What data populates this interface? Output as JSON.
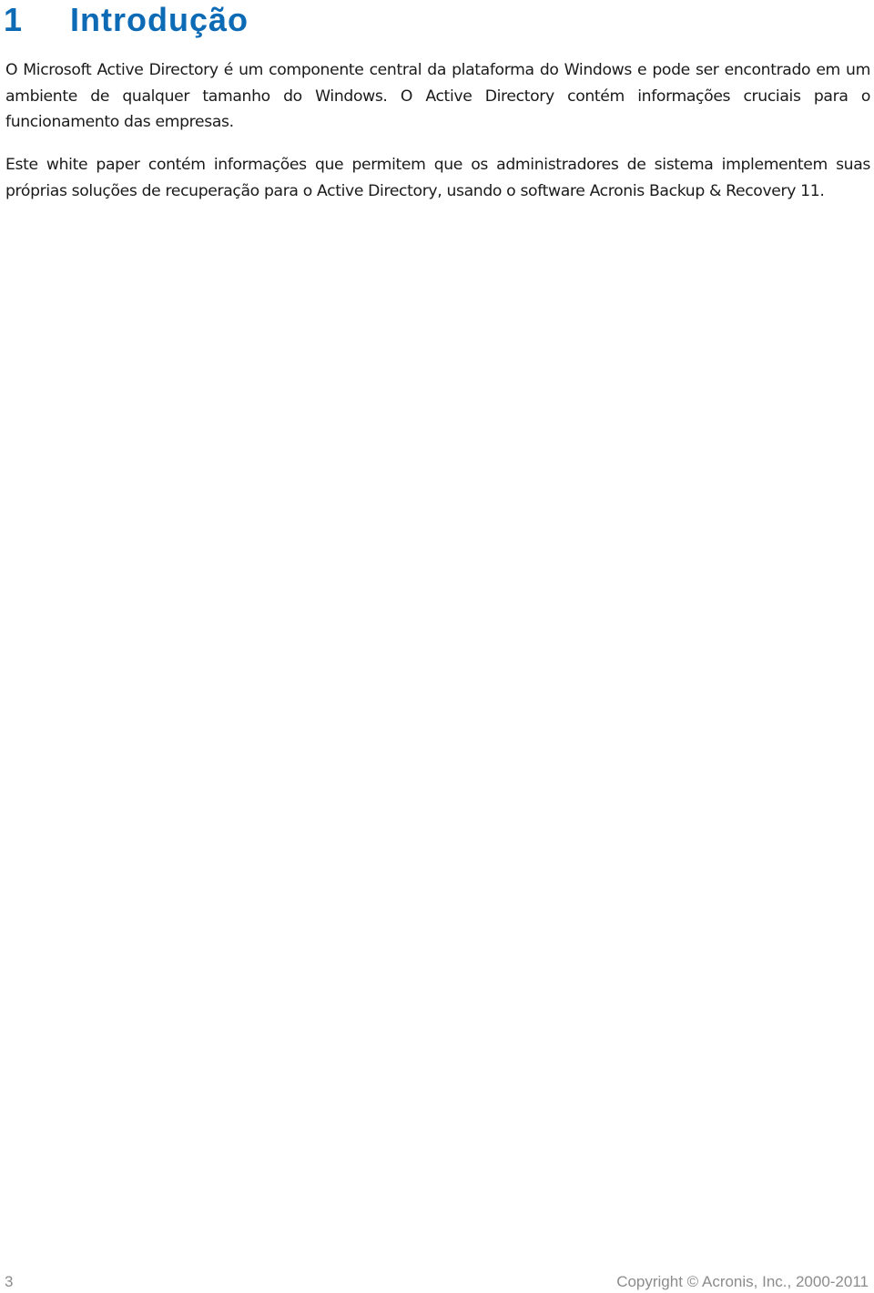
{
  "heading": {
    "number": "1",
    "title": "Introdução"
  },
  "paragraphs": [
    "O Microsoft Active Directory é um componente central da plataforma do Windows e pode ser encontrado em um ambiente de qualquer tamanho do Windows. O Active Directory contém informações cruciais para o funcionamento das empresas.",
    "Este white paper contém informações que permitem que os administradores de sistema implementem suas próprias soluções de recuperação para o Active Directory, usando o software Acronis Backup & Recovery 11."
  ],
  "footer": {
    "page_number": "3",
    "copyright": "Copyright © Acronis, Inc., 2000-2011"
  },
  "colors": {
    "heading": "#0d6ab5",
    "body_text": "#1a1a1a",
    "footer_text": "#8c8c8c"
  }
}
